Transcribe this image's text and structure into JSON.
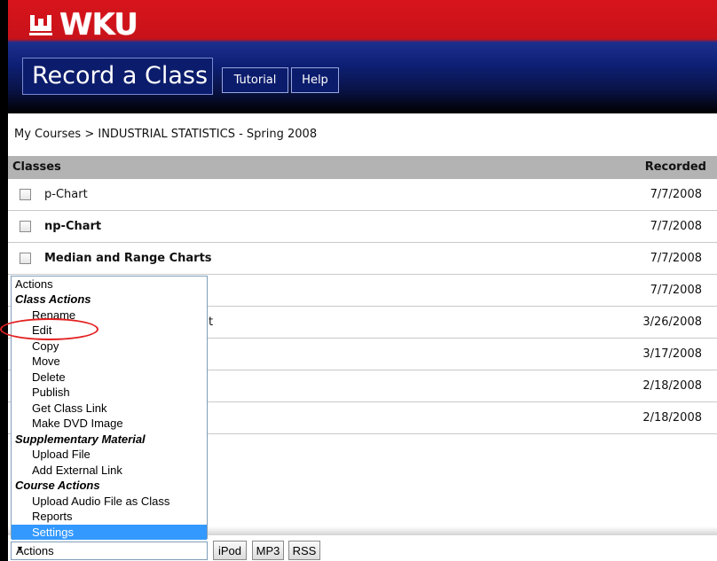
{
  "header": {
    "logo_text": "WKU",
    "app_title": "Record a Class",
    "nav": [
      {
        "label": "Tutorial"
      },
      {
        "label": "Help"
      }
    ]
  },
  "breadcrumb": "My Courses > INDUSTRIAL STATISTICS - Spring 2008",
  "table": {
    "col_classes": "Classes",
    "col_recorded": "Recorded",
    "rows": [
      {
        "title": "p-Chart",
        "date": "7/7/2008",
        "bold": false
      },
      {
        "title": "np-Chart",
        "date": "7/7/2008",
        "bold": true
      },
      {
        "title": "Median and Range Charts",
        "date": "7/7/2008",
        "bold": true
      },
      {
        "title": "",
        "date": "7/7/2008",
        "bold": false
      },
      {
        "title": "t",
        "date": "3/26/2008",
        "bold": false
      },
      {
        "title": "",
        "date": "3/17/2008",
        "bold": false
      },
      {
        "title": "",
        "date": "2/18/2008",
        "bold": false
      },
      {
        "title": "",
        "date": "2/18/2008",
        "bold": false
      }
    ]
  },
  "actions_menu": {
    "first": "Actions",
    "groups": [
      {
        "label": "Class Actions",
        "items": [
          "Rename",
          "Edit",
          "Copy",
          "Move",
          "Delete",
          "Publish",
          "Get Class Link",
          "Make DVD Image"
        ]
      },
      {
        "label": "Supplementary Material",
        "items": [
          "Upload File",
          "Add External Link"
        ]
      },
      {
        "label": "Course Actions",
        "items": [
          "Upload Audio File as Class",
          "Reports",
          "Settings"
        ]
      }
    ],
    "selected": "Settings",
    "select_value": "Actions"
  },
  "feed_buttons": [
    "iPod",
    "MP3",
    "RSS"
  ],
  "colors": {
    "banner_red": "#d8141b",
    "banner_blue": "#0d1f74",
    "header_row": "#b3b3b3",
    "selected": "#3399ff",
    "annotation": "#e32020"
  }
}
